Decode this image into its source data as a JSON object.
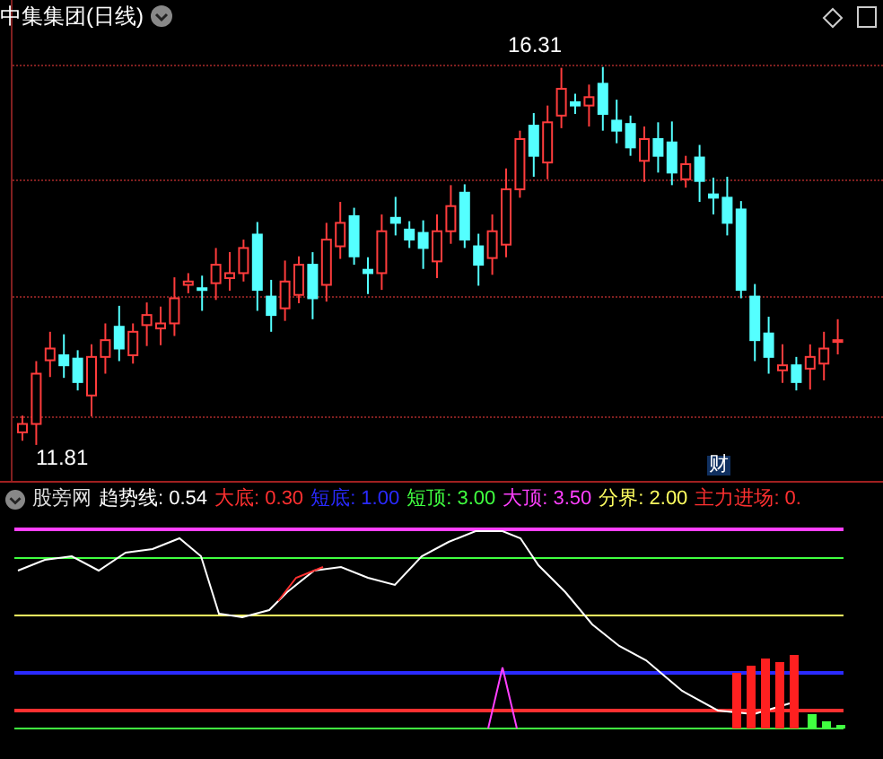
{
  "chart_title": "中集集团(日线)",
  "high_label": "16.31",
  "low_label": "11.81",
  "marker": "财",
  "indicator": {
    "name": "股旁网",
    "items": [
      {
        "label": "趋势线: 0.54",
        "color": "#ffffff"
      },
      {
        "label": "大底: 0.30",
        "color": "#ff3030"
      },
      {
        "label": "短底: 1.00",
        "color": "#2a2aff"
      },
      {
        "label": "短顶: 3.00",
        "color": "#40ff40"
      },
      {
        "label": "大顶: 3.50",
        "color": "#ff40ff"
      },
      {
        "label": "分界: 2.00",
        "color": "#ffff60"
      },
      {
        "label": "主力进场: 0.",
        "color": "#ff3030"
      }
    ]
  }
}
